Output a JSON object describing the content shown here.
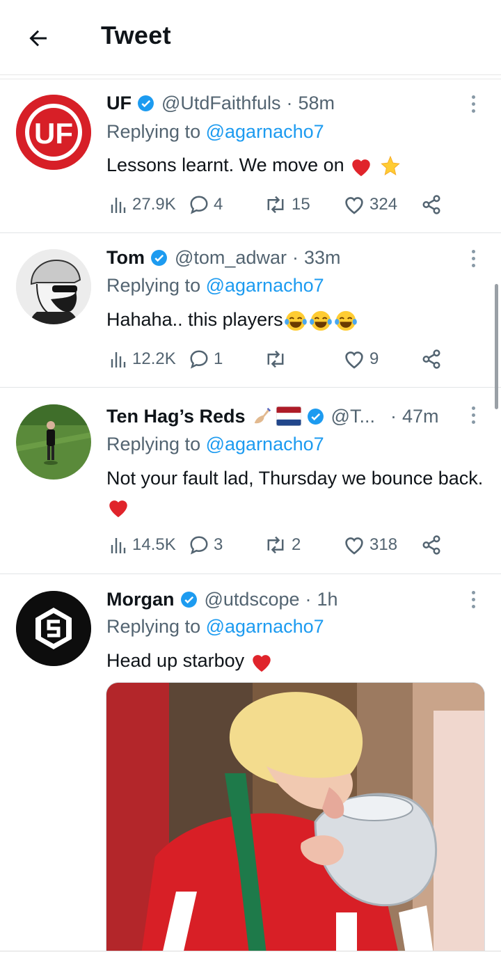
{
  "header": {
    "title": "Tweet",
    "back_icon": "arrow-left-icon"
  },
  "colors": {
    "link": "#1d9bf0",
    "secondary_text": "#536471",
    "verified": "#1d9bf0",
    "heart": "#e0242b"
  },
  "tweets": [
    {
      "name": "UF",
      "handle": "@UtdFaithfuls",
      "dot": "·",
      "time": "58m",
      "replying_prefix": "Replying to",
      "replying_to": "@agarnacho7",
      "text": "Lessons learnt. We move on",
      "avatar_text": "UF",
      "stats": {
        "views": "27.9K",
        "replies": "4",
        "retweets": "15",
        "likes": "324"
      }
    },
    {
      "name": "Tom",
      "handle": "@tom_adwar",
      "dot": "·",
      "time": "33m",
      "replying_prefix": "Replying to",
      "replying_to": "@agarnacho7",
      "text": "Hahaha.. this players",
      "stats": {
        "views": "12.2K",
        "replies": "1",
        "retweets": "",
        "likes": "9"
      }
    },
    {
      "name": "Ten Hag’s Reds",
      "handle": "@T...",
      "dot": "·",
      "time": "47m",
      "replying_prefix": "Replying to",
      "replying_to": "@agarnacho7",
      "text": "Not your fault lad, Thursday we bounce back.",
      "stats": {
        "views": "14.5K",
        "replies": "3",
        "retweets": "2",
        "likes": "318"
      }
    },
    {
      "name": "Morgan",
      "handle": "@utdscope",
      "dot": "·",
      "time": "1h",
      "replying_prefix": "Replying to",
      "replying_to": "@agarnacho7",
      "text": "Head up starboy"
    }
  ]
}
